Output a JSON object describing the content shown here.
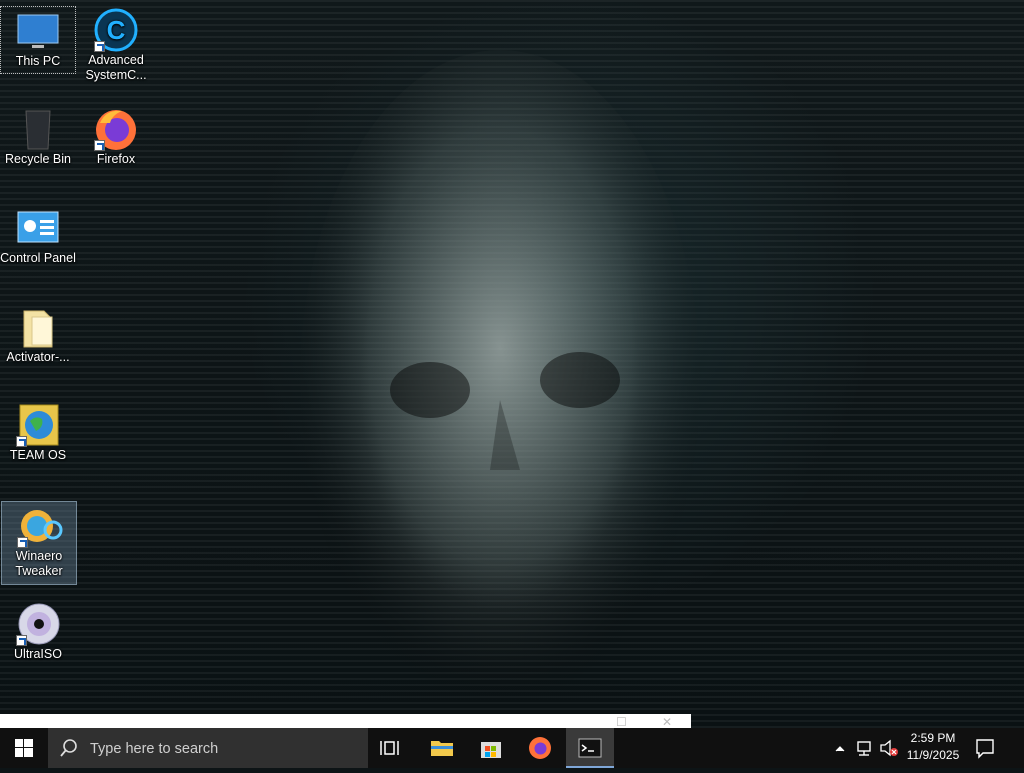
{
  "desktop": {
    "icons": [
      {
        "label": "This PC",
        "icon": "computer-icon"
      },
      {
        "label": "Advanced SystemC...",
        "icon": "advanced-systemcare-icon"
      },
      {
        "label": "Recycle Bin",
        "icon": "recycle-bin-icon"
      },
      {
        "label": "Firefox",
        "icon": "firefox-icon"
      },
      {
        "label": "Control Panel",
        "icon": "control-panel-icon"
      },
      {
        "label": "Activator-...",
        "icon": "folder-icon"
      },
      {
        "label": "TEAM OS",
        "icon": "team-os-globe-icon"
      },
      {
        "label": "Winaero Tweaker",
        "icon": "winaero-tweaker-icon"
      },
      {
        "label": "UltraISO",
        "icon": "ultraiso-disc-icon"
      }
    ]
  },
  "taskbar": {
    "search_placeholder": "Type here to search",
    "pinned": [
      {
        "name": "task-view",
        "icon": "task-view-icon"
      },
      {
        "name": "file-explorer",
        "icon": "folder-icon"
      },
      {
        "name": "microsoft-store",
        "icon": "store-icon"
      },
      {
        "name": "firefox",
        "icon": "firefox-icon"
      },
      {
        "name": "command-prompt",
        "icon": "terminal-icon",
        "active": true
      }
    ],
    "tray": {
      "time": "2:59 PM",
      "date": "11/9/2025",
      "icons": [
        "chevron-up-icon",
        "network-icon",
        "volume-muted-icon",
        "notification-icon"
      ]
    }
  },
  "colors": {
    "taskbar_bg": "#101010",
    "search_bg": "#303030",
    "accent": "#7fa7d8"
  }
}
